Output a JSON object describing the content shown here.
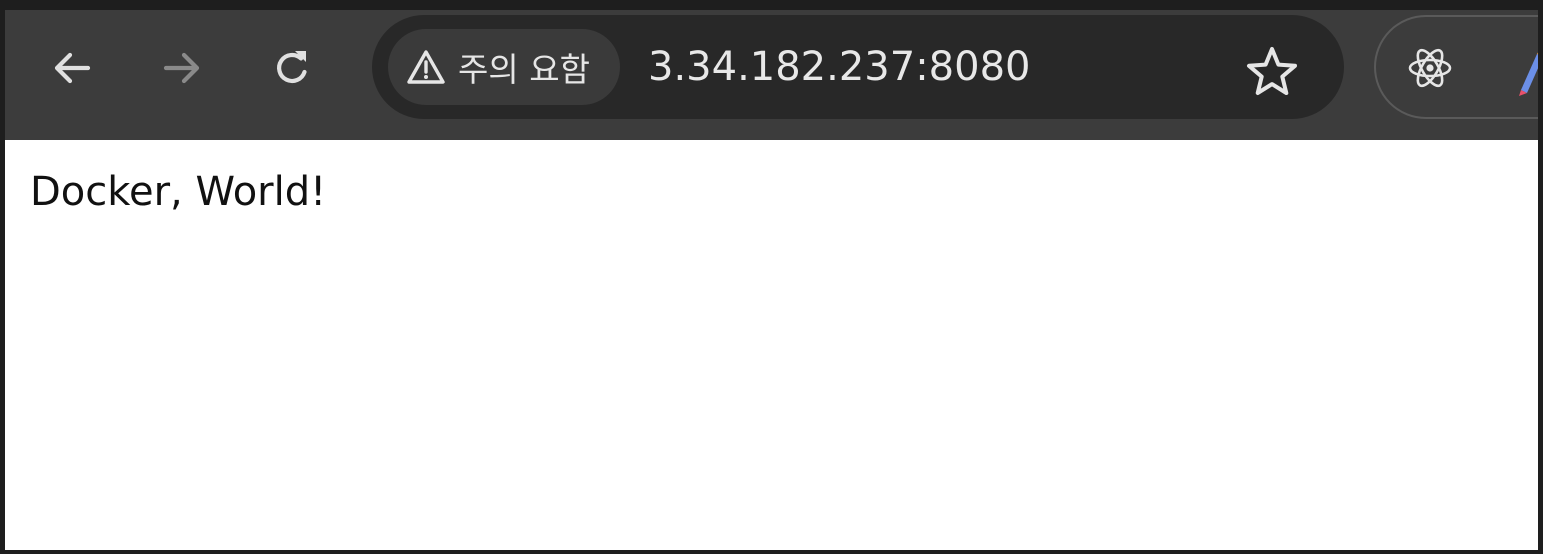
{
  "toolbar": {
    "security_chip": {
      "icon": "warning-triangle-icon",
      "label": "주의 요함"
    },
    "address": "3.34.182.237:8080",
    "buttons": {
      "back": "back-arrow-icon",
      "forward": "forward-arrow-icon",
      "reload": "reload-icon",
      "bookmark": "star-icon"
    },
    "extensions": [
      "react-devtools-icon",
      "pen-extension-icon"
    ]
  },
  "page": {
    "body_text": "Docker, World!"
  },
  "colors": {
    "toolbar_bg": "#3c3c3c",
    "omnibox_bg": "#282828",
    "chip_bg": "#3a3a3a",
    "icon_active": "#e0e0e0",
    "icon_disabled": "#8a8a8a",
    "page_bg": "#ffffff"
  }
}
